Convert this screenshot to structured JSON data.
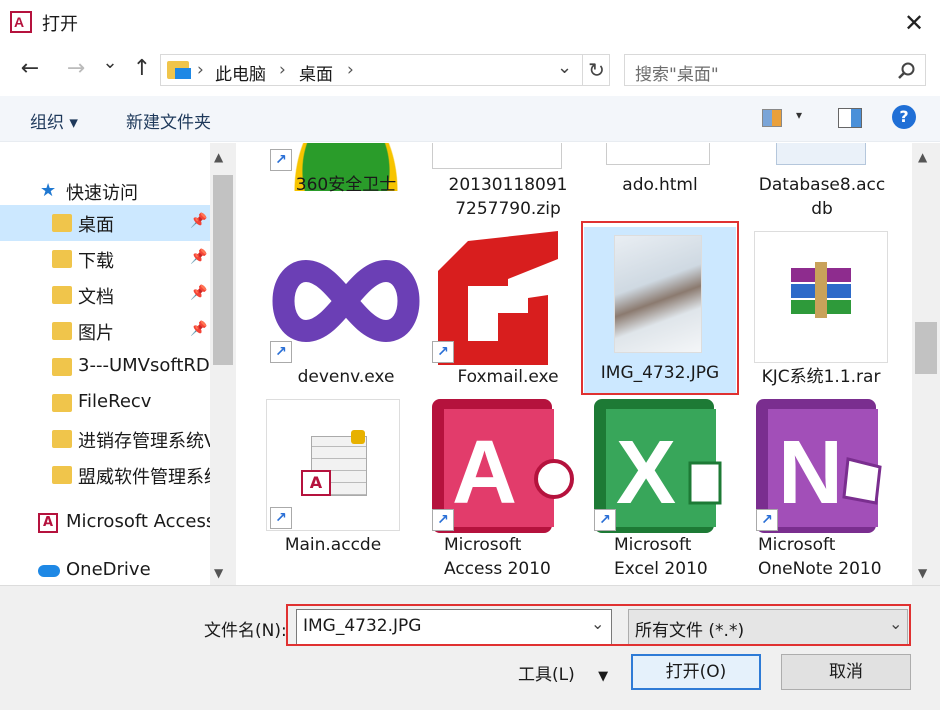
{
  "window": {
    "title": "打开",
    "close_glyph": "✕"
  },
  "nav": {
    "back": "←",
    "forward": "→",
    "history": "⌄",
    "up": "↑"
  },
  "address": {
    "sep": "›",
    "crumbs": [
      "此电脑",
      "桌面"
    ],
    "refresh": "↻"
  },
  "search": {
    "placeholder": "搜索\"桌面\""
  },
  "toolbar": {
    "organize": "组织 ▾",
    "new_folder": "新建文件夹",
    "help": "?"
  },
  "sidebar": {
    "items": [
      {
        "label": "快速访问",
        "icon": "star-icon"
      },
      {
        "label": "桌面",
        "icon": "folder-icon",
        "pinned": true,
        "selected": true
      },
      {
        "label": "下载",
        "icon": "download-folder-icon",
        "pinned": true
      },
      {
        "label": "文档",
        "icon": "documents-folder-icon",
        "pinned": true
      },
      {
        "label": "图片",
        "icon": "pictures-folder-icon",
        "pinned": true
      },
      {
        "label": "3---UMVsoftRD",
        "icon": "folder-icon"
      },
      {
        "label": "FileRecv",
        "icon": "folder-icon"
      },
      {
        "label": "进销存管理系统V",
        "icon": "folder-icon"
      },
      {
        "label": "盟威软件管理系统",
        "icon": "folder-icon"
      },
      {
        "label": "Microsoft Access",
        "icon": "access-icon"
      },
      {
        "label": "OneDrive",
        "icon": "cloud-icon"
      }
    ]
  },
  "files": [
    {
      "name": "360安全卫士",
      "icon": "360-icon"
    },
    {
      "name": "20130118091\n7257790.zip",
      "icon": "zip-icon"
    },
    {
      "name": "ado.html",
      "icon": "html-icon"
    },
    {
      "name": "Database8.acc\ndb",
      "icon": "accdb-icon"
    },
    {
      "name": "devenv.exe",
      "icon": "visual-studio-icon"
    },
    {
      "name": "Foxmail.exe",
      "icon": "foxmail-icon"
    },
    {
      "name": "IMG_4732.JPG",
      "icon": "photo-icon",
      "selected": true
    },
    {
      "name": "KJC系统1.1.rar",
      "icon": "rar-icon"
    },
    {
      "name": "Main.accde",
      "icon": "accde-icon"
    },
    {
      "name": "Microsoft\nAccess 2010",
      "icon": "access-icon",
      "letter": "A"
    },
    {
      "name": "Microsoft\nExcel 2010",
      "icon": "excel-icon",
      "letter": "X"
    },
    {
      "name": "Microsoft\nOneNote 2010",
      "icon": "onenote-icon",
      "letter": "N"
    }
  ],
  "footer": {
    "filename_label": "文件名(N):",
    "filename_value": "IMG_4732.JPG",
    "filetype_value": "所有文件 (*.*)",
    "tools": "工具(L)",
    "open": "打开(O)",
    "cancel": "取消"
  },
  "colors": {
    "accent": "#2e7bd6",
    "highlight": "#e03131",
    "selection": "#cce8ff"
  }
}
